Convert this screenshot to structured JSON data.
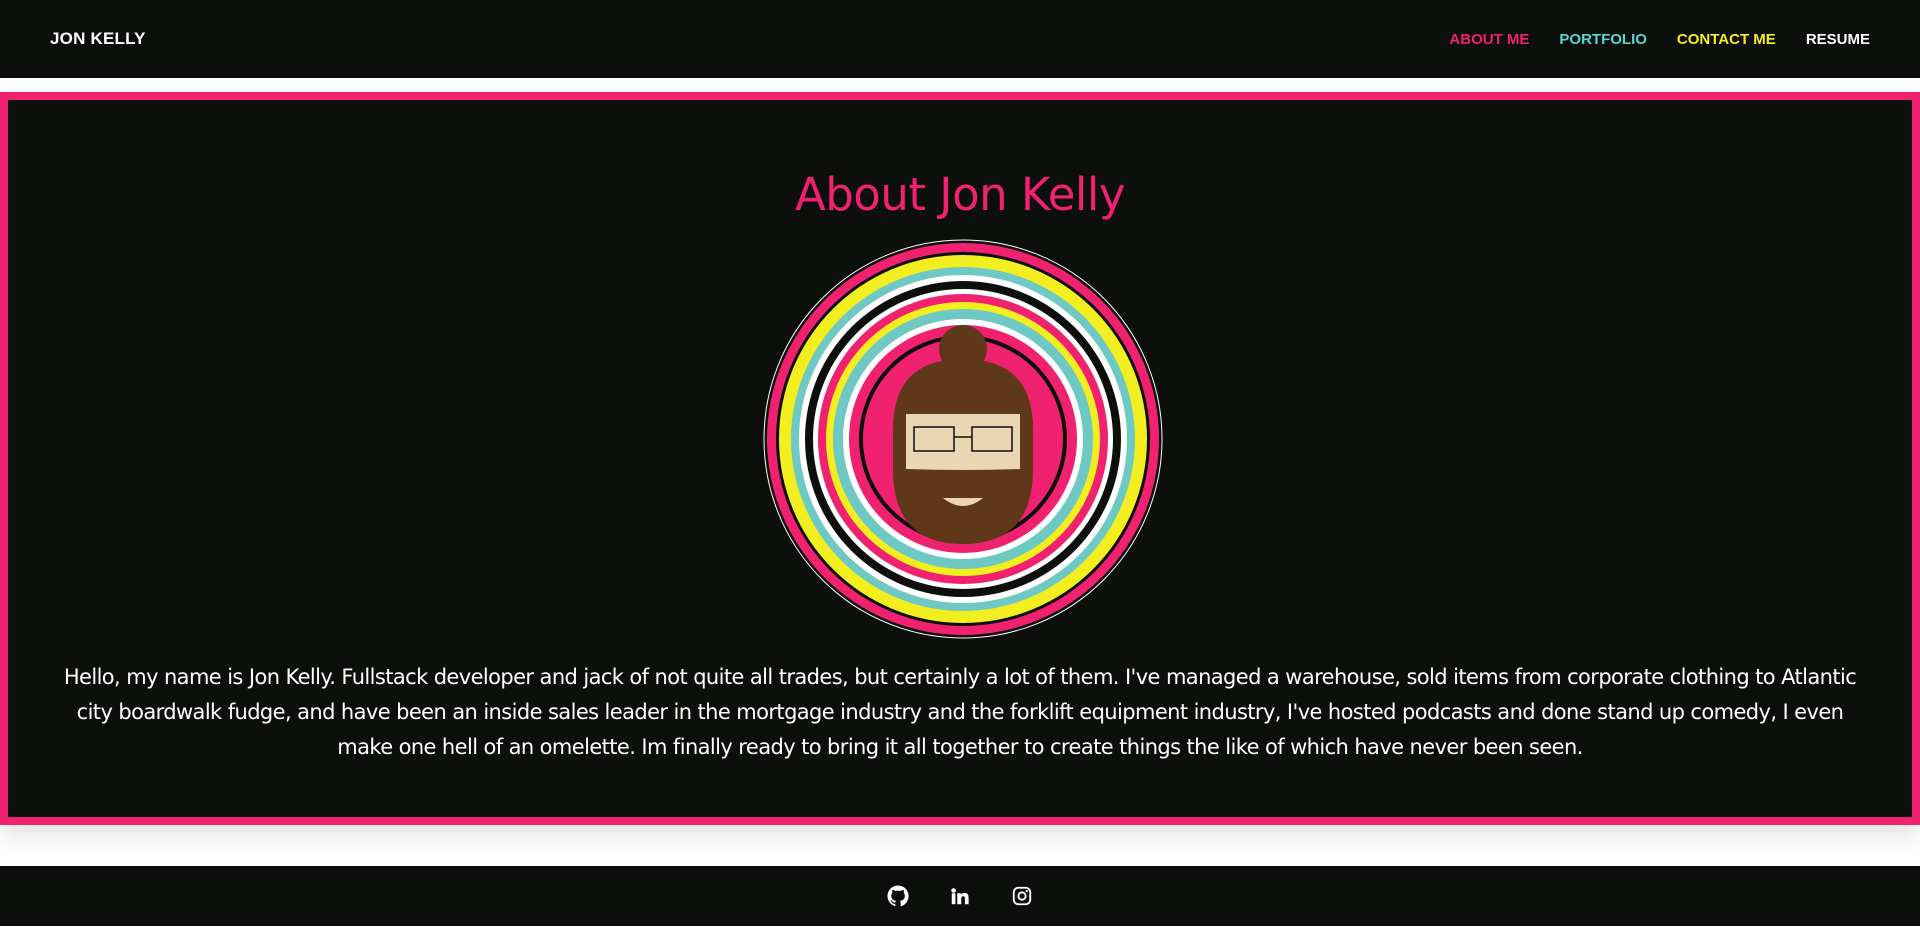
{
  "navbar": {
    "brand": "JON KELLY",
    "links": [
      {
        "label": "ABOUT ME",
        "color": "#f0226f"
      },
      {
        "label": "PORTFOLIO",
        "color": "#5ad6c9"
      },
      {
        "label": "CONTACT ME",
        "color": "#f2ee1f"
      },
      {
        "label": "RESUME",
        "color": "#ffffff"
      }
    ]
  },
  "about": {
    "title": "About Jon Kelly",
    "bio": "Hello, my name is Jon Kelly. Fullstack developer and jack of not quite all trades, but certainly a lot of them. I've managed a warehouse, sold items from corporate clothing to Atlantic city boardwalk fudge, and have been an inside sales leader in the mortgage industry and the forklift equipment industry, I've hosted podcasts and done stand up comedy, I even make one hell of an omelette. Im finally ready to bring it all together to create things the like of which have never been seen."
  },
  "footer": {
    "icons": [
      "github-icon",
      "linkedin-icon",
      "instagram-icon"
    ]
  },
  "colors": {
    "accent": "#f0226f",
    "teal": "#6ec9c4",
    "yellow": "#f2ee1f",
    "background": "#0d0f0c"
  }
}
